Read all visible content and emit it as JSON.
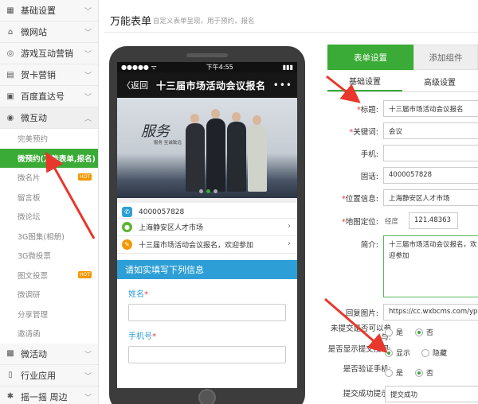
{
  "sidebar": {
    "groups_top": [
      {
        "icon": "grid-icon",
        "glyph": "▦",
        "label": "基础设置"
      },
      {
        "icon": "home-icon",
        "glyph": "⌂",
        "label": "微网站"
      },
      {
        "icon": "gamepad-icon",
        "glyph": "◎",
        "label": "游戏互动营销"
      },
      {
        "icon": "gift-icon",
        "glyph": "▤",
        "label": "贺卡营销"
      },
      {
        "icon": "clipboard-icon",
        "glyph": "▣",
        "label": "百度直达号"
      },
      {
        "icon": "chat-icon",
        "glyph": "◉",
        "label": "微互动"
      }
    ],
    "sub_items": [
      {
        "label": "完美预约",
        "hot": ""
      },
      {
        "label": "微预约(万能表单,报名)",
        "hot": ""
      },
      {
        "label": "微名片",
        "hot": "HOT"
      },
      {
        "label": "留言板",
        "hot": ""
      },
      {
        "label": "微论坛",
        "hot": ""
      },
      {
        "label": "3G图集(相册)",
        "hot": ""
      },
      {
        "label": "3G微投票",
        "hot": ""
      },
      {
        "label": "图文投票",
        "hot": "HOT"
      },
      {
        "label": "微调研",
        "hot": ""
      },
      {
        "label": "分享管理",
        "hot": ""
      },
      {
        "label": "邀请函",
        "hot": ""
      }
    ],
    "groups_bottom": [
      {
        "icon": "ticket-icon",
        "glyph": "▩",
        "label": "微活动"
      },
      {
        "icon": "phone-icon",
        "glyph": "▯",
        "label": "行业应用"
      },
      {
        "icon": "shake-icon",
        "glyph": "✱",
        "label": "摇一摇 周边"
      }
    ],
    "active_sub": "微预约(万能表单,报名)"
  },
  "header": {
    "title": "万能表单",
    "subtitle": "自定义表单呈现，用于预约，报名"
  },
  "phone": {
    "status_dots": "●●●●●",
    "status_wifi": "ᯤ",
    "status_time": "下午4:55",
    "status_battery": "▮▮▮",
    "back_label": "〈返回",
    "nav_title": "十三届市场活动会议报名",
    "more": "•••",
    "banner_logo": "服务",
    "banner_slogan": "服务   至诚致远",
    "phone_number": "4000057828",
    "location": "上海静安区人才市场",
    "intro": "十三届市场活动会议报名，欢迎参加",
    "form_header": "请如实填写下列信息",
    "field_name": "姓名",
    "field_mobile": "手机号",
    "required_mark": "*"
  },
  "settings": {
    "tab_form": "表单设置",
    "tab_add": "添加组件",
    "subtab_basic": "基础设置",
    "subtab_advanced": "高级设置",
    "title_label": "标题:",
    "title_value": "十三届市场活动会议报名",
    "keyword_label": "关键词:",
    "keyword_value": "会议",
    "mobile_label": "手机:",
    "mobile_value": "",
    "tel_label": "固话:",
    "tel_value": "4000057828",
    "location_label": "位置信息:",
    "location_value": "上海静安区人才市场",
    "map_label": "地图定位:",
    "longitude_label": "经度",
    "longitude_value": "121.48363",
    "intro_label": "简介:",
    "intro_value": "十三届市场活动会议报名，欢迎参加",
    "reply_image_label": "回复图片:",
    "reply_image_value": "https://cc.wxbcms.com/yplog",
    "q_submitted_label": "未提交是否可以参与:",
    "q_show_submit_label": "是否显示提交按钮:",
    "q_verify_mobile_label": "是否验证手机:",
    "opt_yes": "是",
    "opt_no": "否",
    "opt_show": "显示",
    "opt_hide": "隐藏",
    "success_label": "提交成功提示:",
    "success_value": "提交成功",
    "accent": "#3aab36"
  }
}
